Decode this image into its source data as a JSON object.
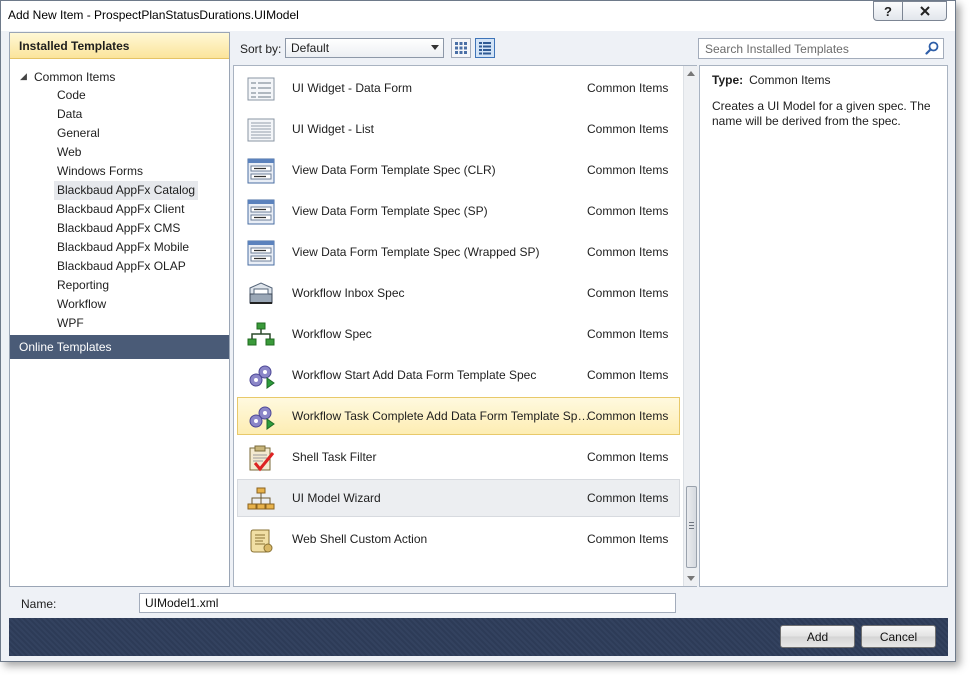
{
  "window": {
    "title": "Add New Item - ProspectPlanStatusDurations.UIModel",
    "help_label": "?"
  },
  "left_panel": {
    "installed_header": "Installed Templates",
    "root": "Common Items",
    "items": [
      "Code",
      "Data",
      "General",
      "Web",
      "Windows Forms",
      "Blackbaud AppFx Catalog",
      "Blackbaud AppFx Client",
      "Blackbaud AppFx CMS",
      "Blackbaud AppFx Mobile",
      "Blackbaud AppFx OLAP",
      "Reporting",
      "Workflow",
      "WPF"
    ],
    "selected_item": "Blackbaud AppFx Catalog",
    "online_header": "Online Templates"
  },
  "toolbar": {
    "sort_label": "Sort by:",
    "sort_value": "Default",
    "search_placeholder": "Search Installed Templates"
  },
  "templates": [
    {
      "name": "UI Widget - Data Form",
      "category": "Common Items",
      "icon": "form-grid-icon"
    },
    {
      "name": "UI Widget - List",
      "category": "Common Items",
      "icon": "list-grid-icon"
    },
    {
      "name": "View Data Form Template Spec (CLR)",
      "category": "Common Items",
      "icon": "view-form-icon"
    },
    {
      "name": "View Data Form Template Spec (SP)",
      "category": "Common Items",
      "icon": "view-form-icon"
    },
    {
      "name": "View Data Form Template Spec (Wrapped SP)",
      "category": "Common Items",
      "icon": "view-form-icon"
    },
    {
      "name": "Workflow Inbox Spec",
      "category": "Common Items",
      "icon": "inbox-tray-icon"
    },
    {
      "name": "Workflow Spec",
      "category": "Common Items",
      "icon": "workflow-tree-icon"
    },
    {
      "name": "Workflow Start Add Data Form Template Spec",
      "category": "Common Items",
      "icon": "gears-play-icon"
    },
    {
      "name": "Workflow Task Complete Add Data Form Template Spec",
      "category": "Common Items",
      "icon": "gears-play-icon"
    },
    {
      "name": "Shell Task Filter",
      "category": "Common Items",
      "icon": "clipboard-check-icon"
    },
    {
      "name": "UI Model Wizard",
      "category": "Common Items",
      "icon": "hierarchy-icon"
    },
    {
      "name": "Web Shell Custom Action",
      "category": "Common Items",
      "icon": "scroll-icon"
    }
  ],
  "selected_template": "Workflow Task Complete Add Data Form Template Spec",
  "hover_template": "UI Model Wizard",
  "details": {
    "type_label": "Type:",
    "type_value": "Common Items",
    "description": "Creates a UI Model for a given spec.  The name will be derived from the spec."
  },
  "name_field": {
    "label": "Name:",
    "value": "UIModel1.xml"
  },
  "buttons": {
    "add": "Add",
    "cancel": "Cancel"
  },
  "colors": {
    "selection_fill": "#fdedb3",
    "online_header_bg": "#4a5b77",
    "bottom_bar": "#2d3b57"
  }
}
